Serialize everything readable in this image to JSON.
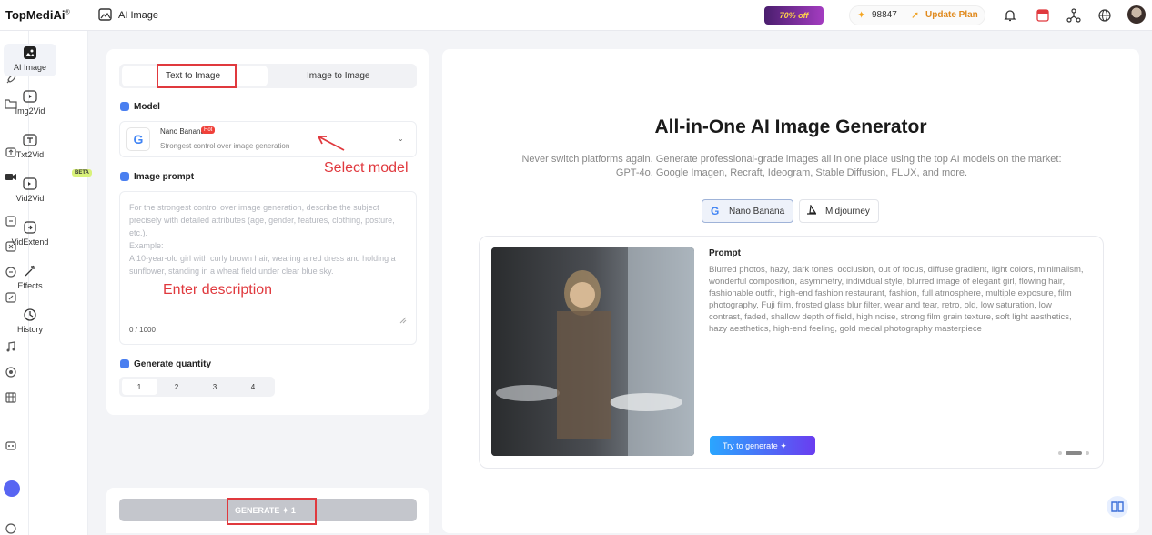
{
  "header": {
    "logo_text": "TopMediAi",
    "logo_reg": "®",
    "page_title": "AI Image",
    "promo_badge": "70% off",
    "credits": "98847",
    "update_plan": "Update Plan",
    "icons": [
      "bell-icon",
      "calendar-icon",
      "share-icon",
      "globe-icon",
      "avatar"
    ]
  },
  "rail": {
    "icons": [
      "home-icon",
      "rocket-icon",
      "folder-icon",
      "upload-icon",
      "camera-icon",
      "convert-icon",
      "replace-icon",
      "translate-icon",
      "edit-icon",
      "music-icon",
      "target-icon",
      "grid-icon",
      "robot-icon",
      "discord-icon",
      "chat-icon"
    ]
  },
  "nav": {
    "items": [
      {
        "label": "AI Image",
        "icon": "image-icon"
      },
      {
        "label": "Img2Vid",
        "icon": "image-video-icon"
      },
      {
        "label": "Txt2Vid",
        "icon": "text-video-icon"
      },
      {
        "label": "Vid2Vid",
        "icon": "video-video-icon"
      },
      {
        "label": "VidExtend",
        "icon": "extend-icon"
      },
      {
        "label": "Effects",
        "icon": "sparkle-icon"
      },
      {
        "label": "History",
        "icon": "clock-icon"
      }
    ],
    "beta_badge": "BETA"
  },
  "form": {
    "tabs": [
      "Text to Image",
      "Image to Image"
    ],
    "model_heading": "Model",
    "model_name": "Nano Banana",
    "model_badge": "Hot",
    "model_desc": "Strongest control over image generation",
    "annotation_model": "Select model",
    "prompt_heading": "Image prompt",
    "prompt_placeholder": "For the strongest control over image generation, describe the subject precisely with detailed attributes (age, gender, features, clothing, posture, etc.).\n Example:\n A 10-year-old girl with curly brown hair, wearing a red dress and holding a sunflower, standing in a wheat field under clear blue sky.",
    "annotation_prompt": "Enter description",
    "char_count": "0 / 1000",
    "qty_heading": "Generate quantity",
    "qty_options": [
      "1",
      "2",
      "3",
      "4"
    ],
    "generate_label": "GENERATE",
    "generate_cost": "1"
  },
  "showcase": {
    "headline": "All-in-One AI Image Generator",
    "subtext": "Never switch platforms again. Generate professional-grade images all in one place using the top AI models on the market: GPT-4o, Google Imagen, Recraft, Ideogram, Stable Diffusion, FLUX, and more.",
    "model_tabs": [
      "Nano Banana",
      "Midjourney"
    ],
    "prompt_heading": "Prompt",
    "prompt_text": "Blurred photos, hazy, dark tones, occlusion, out of focus, diffuse gradient, light colors, minimalism, wonderful composition, asymmetry, individual style, blurred image of elegant girl, flowing hair, fashionable outfit, high-end fashion restaurant, fashion, full atmosphere, multiple exposure, film photography, Fuji film, frosted glass blur filter, wear and tear, retro, old, low saturation, low contrast, faded, shallow depth of field, high noise, strong film grain texture, soft light aesthetics, hazy aesthetics, high-end feeling, gold medal photography masterpiece",
    "try_button": "Try to generate"
  },
  "colors": {
    "accent_red": "#e0393e",
    "try_start": "#2aa6ff",
    "try_end": "#6a3df0",
    "update": "#e08a1e"
  }
}
